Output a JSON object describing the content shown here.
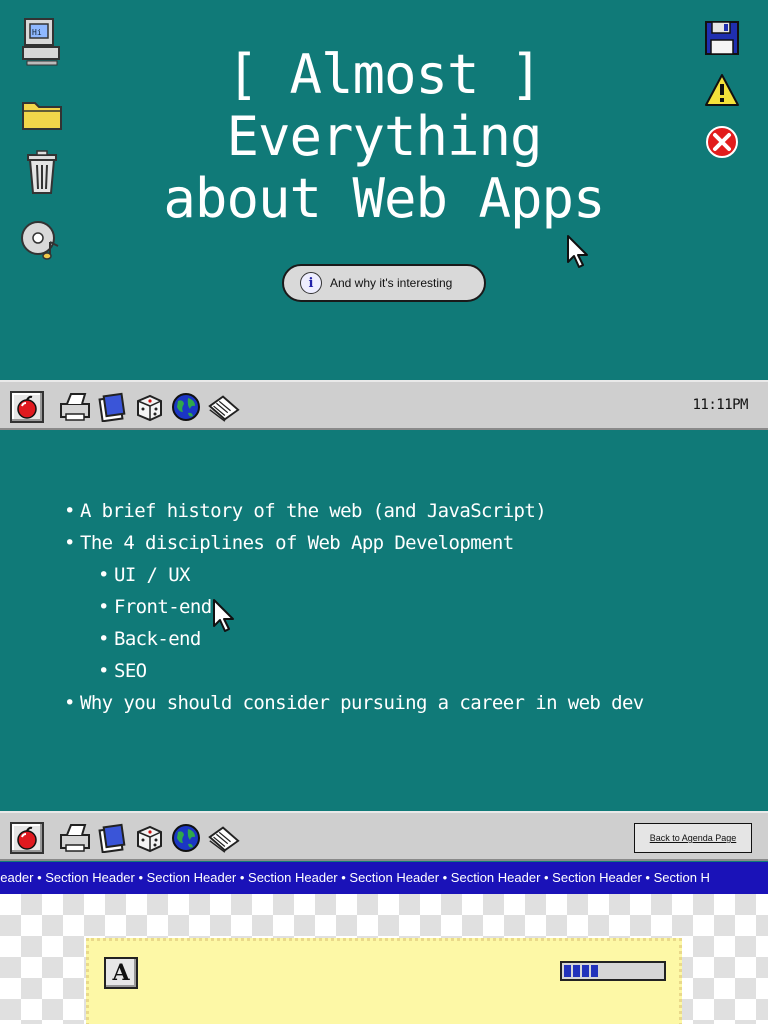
{
  "slide1": {
    "title_line1": "[ Almost ]",
    "title_line2": "Everything",
    "title_line3": "about Web Apps",
    "subtitle": "And why it's interesting",
    "info_icon": "i",
    "left_icons": [
      "computer-icon",
      "folder-icon",
      "trash-icon",
      "cd-music-icon"
    ],
    "right_icons": [
      "floppy-disk-icon",
      "warning-icon",
      "error-close-icon"
    ]
  },
  "taskbar": {
    "clock": "11:11PM",
    "icons": [
      "printer-icon",
      "notepad-icon",
      "dice-icon",
      "globe-icon",
      "papers-icon"
    ]
  },
  "slide2": {
    "bullets": [
      "A brief history of the web (and JavaScript)",
      "The 4 disciplines of Web App Development",
      "UI / UX",
      "Front-end",
      "Back-end",
      "SEO",
      "Why you should consider pursuing a career in web dev"
    ]
  },
  "taskbar2": {
    "back_button": "Back to Agenda Page"
  },
  "marquee": {
    "text": "n Header • Section Header • Section Header • Section Header • Section Header • Section Header • Section Header • Section H"
  },
  "note": {
    "font_icon": "A",
    "progress": 0.35
  },
  "colors": {
    "teal": "#107a78",
    "taskbar": "#cfcfcf",
    "marquee": "#1a12b8",
    "note": "#fdf8a6"
  }
}
